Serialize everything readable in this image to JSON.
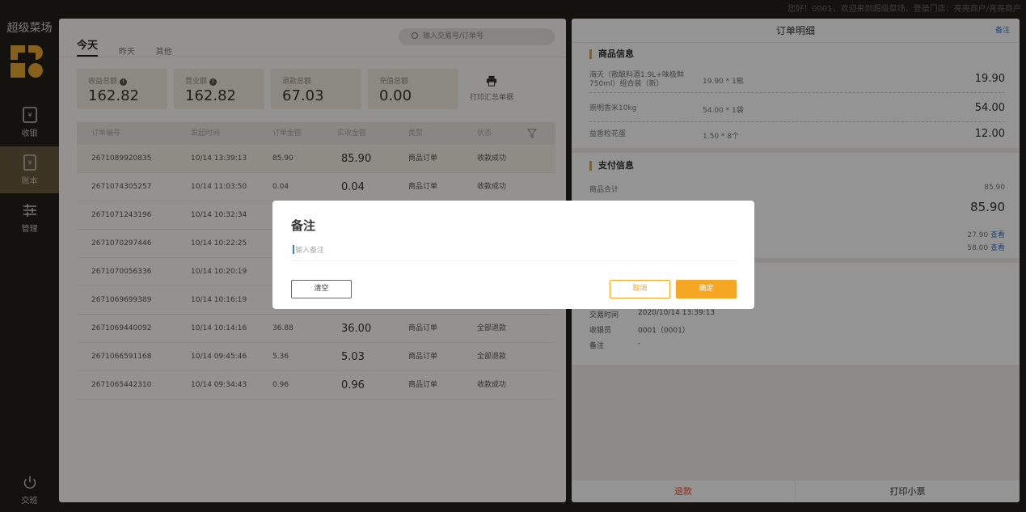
{
  "topbar": {
    "greeting": "您好！0001，欢迎来到超级菜场，登录门店：亮亮商户/亮亮商户"
  },
  "sidebar": {
    "brand": "超级菜场",
    "items": [
      {
        "label": "收银",
        "icon": "cashier-icon"
      },
      {
        "label": "账本",
        "icon": "ledger-icon"
      },
      {
        "label": "管理",
        "icon": "settings-sliders-icon"
      }
    ],
    "logout": {
      "label": "交班",
      "icon": "power-icon"
    }
  },
  "left": {
    "tabs": [
      "今天",
      "昨天",
      "其他"
    ],
    "search_placeholder": "输入交易号/订单号",
    "stats": [
      {
        "label": "收益总额",
        "value": "162.82",
        "info": true
      },
      {
        "label": "营业额",
        "value": "162.82",
        "info": true
      },
      {
        "label": "退款总额",
        "value": "67.03",
        "info": false
      },
      {
        "label": "充值总额",
        "value": "0.00",
        "info": false
      }
    ],
    "print_summary": "打印汇总单据",
    "columns": [
      "订单编号",
      "发起时间",
      "订单金额",
      "实收金额",
      "类型",
      "状态"
    ],
    "rows": [
      {
        "id": "2671089920835",
        "time": "10/14 13:39:13",
        "amount": "85.90",
        "paid": "85.90",
        "type": "商品订单",
        "status": "收款成功"
      },
      {
        "id": "2671074305257",
        "time": "10/14 11:03:50",
        "amount": "0.04",
        "paid": "0.04",
        "type": "商品订单",
        "status": "收款成功"
      },
      {
        "id": "2671071243196",
        "time": "10/14 10:32:34",
        "amount": "",
        "paid": "",
        "type": "",
        "status": ""
      },
      {
        "id": "2671070297446",
        "time": "10/14 10:22:25",
        "amount": "",
        "paid": "",
        "type": "",
        "status": ""
      },
      {
        "id": "2671070056336",
        "time": "10/14 10:20:19",
        "amount": "",
        "paid": "",
        "type": "",
        "status": ""
      },
      {
        "id": "2671069699389",
        "time": "10/14 10:16:19",
        "amount": "",
        "paid": "",
        "type": "",
        "status": ""
      },
      {
        "id": "2671069440092",
        "time": "10/14 10:14:16",
        "amount": "36.88",
        "paid": "36.00",
        "type": "商品订单",
        "status": "全部退款"
      },
      {
        "id": "2671066591168",
        "time": "10/14 09:45:46",
        "amount": "5.36",
        "paid": "5.03",
        "type": "商品订单",
        "status": "全部退款"
      },
      {
        "id": "2671065442310",
        "time": "10/14 09:34:43",
        "amount": "0.96",
        "paid": "0.96",
        "type": "商品订单",
        "status": "收款成功"
      }
    ]
  },
  "right": {
    "title": "订单明细",
    "note_link": "备注",
    "goods_title": "商品信息",
    "goods": [
      {
        "name": "海天（散酿料酒1.9L+味极鲜750ml）组合装（新）",
        "qty": "19.90 * 1瓶",
        "price": "19.90"
      },
      {
        "name": "崇明香米10kg",
        "qty": "54.00 * 1袋",
        "price": "54.00"
      },
      {
        "name": "益香粒花蛋",
        "qty": "1.50 * 8个",
        "price": "12.00"
      }
    ],
    "pay_title": "支付信息",
    "goods_total_label": "商品合计",
    "goods_total_value": "85.90",
    "paid_big": "85.90",
    "pay_lines": [
      {
        "value": "27.90",
        "link": "查看"
      },
      {
        "value": "58.00",
        "link": "查看"
      }
    ],
    "info": [
      {
        "label": "交易时间",
        "value": "2020/10/14 13:39:13"
      },
      {
        "label": "收银员",
        "value": "0001（0001）"
      },
      {
        "label": "备注",
        "value": "-"
      }
    ],
    "refund_button": "退款",
    "print_button": "打印小票"
  },
  "modal": {
    "title": "备注",
    "placeholder": "输入备注",
    "clear": "清空",
    "cancel": "取消",
    "confirm": "确定"
  },
  "colors": {
    "accent": "#f5a623",
    "brand_gold": "#e9a72b",
    "link": "#3b7bd6",
    "refund_red": "#e0533a"
  }
}
